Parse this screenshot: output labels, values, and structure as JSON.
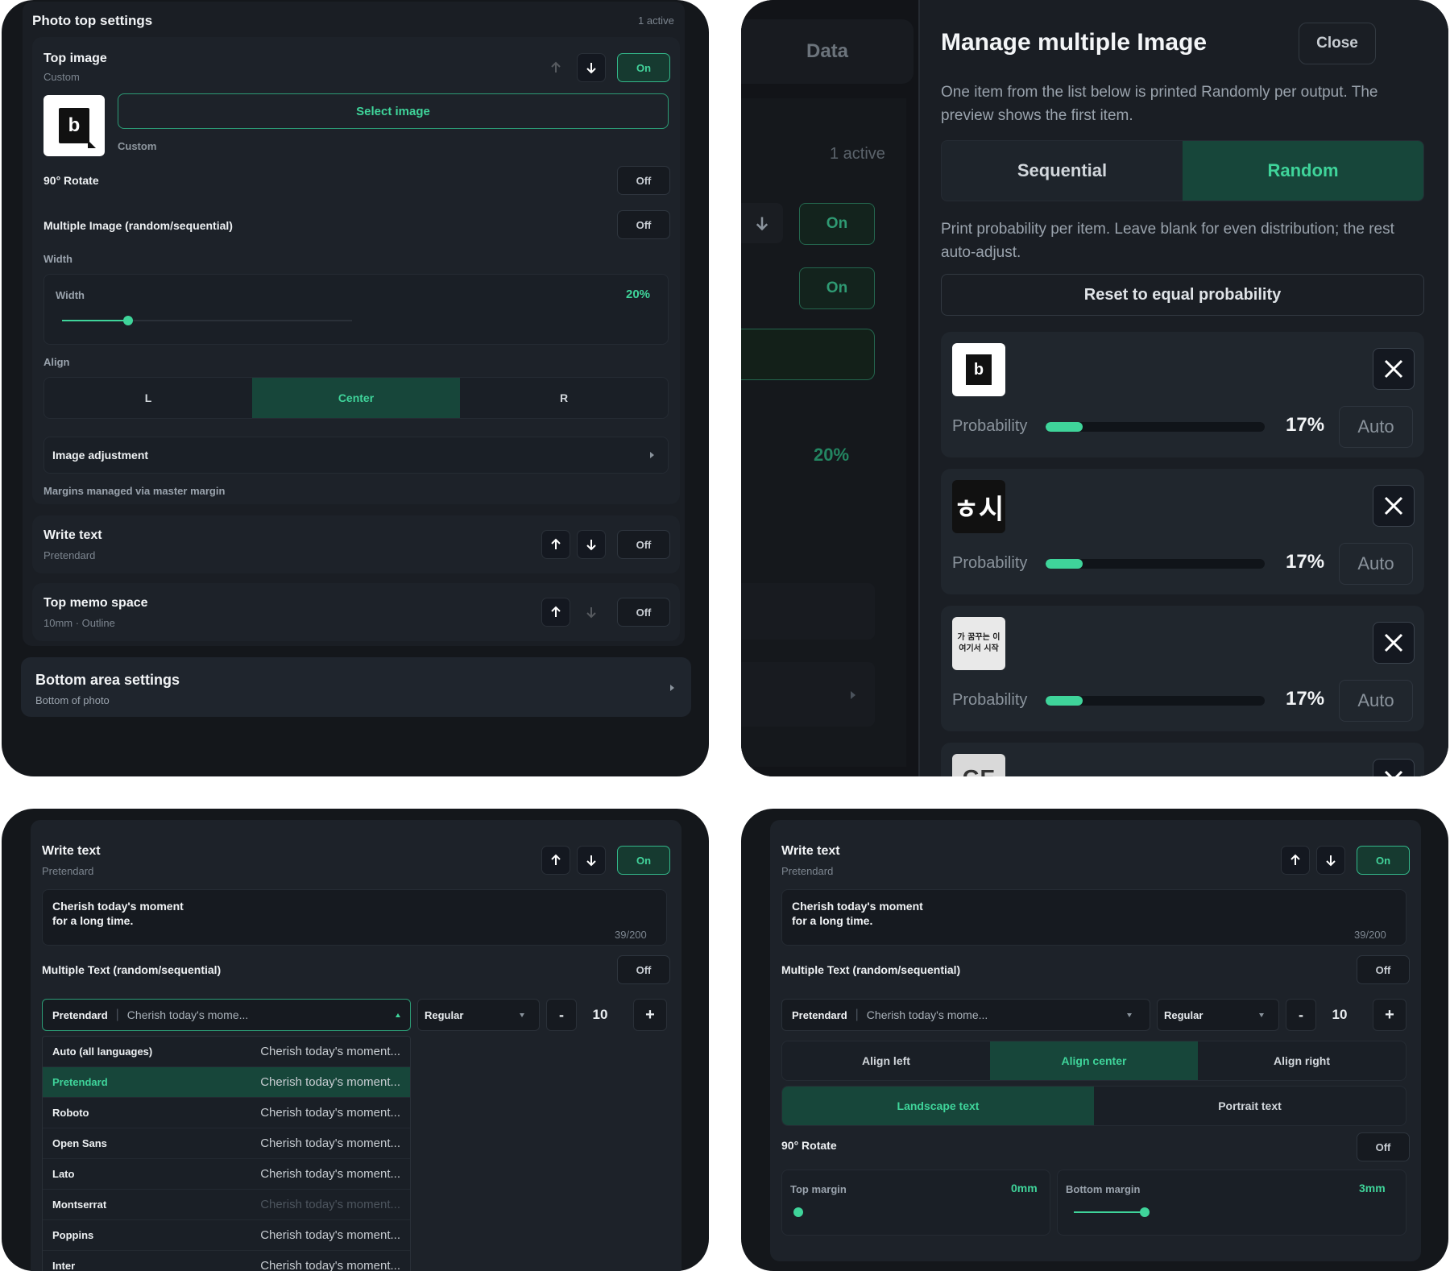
{
  "panel1": {
    "header_title": "Photo top settings",
    "header_status": "1 active",
    "top_image": {
      "title": "Top image",
      "subtitle": "Custom",
      "toggle": "On",
      "select_button": "Select image",
      "thumb_caption": "Custom",
      "thumb_glyph": "b"
    },
    "rotate": {
      "label": "90° Rotate",
      "toggle": "Off"
    },
    "multi_image": {
      "label": "Multiple Image (random/sequential)",
      "toggle": "Off"
    },
    "width_section_label": "Width",
    "width_slider": {
      "label": "Width",
      "value": "20%",
      "fraction": 0.2
    },
    "align_label": "Align",
    "align_options": [
      "L",
      "Center",
      "R"
    ],
    "align_selected": "Center",
    "image_adjustment": "Image adjustment",
    "margins_note": "Margins managed via master margin",
    "write_text": {
      "title": "Write text",
      "subtitle": "Pretendard",
      "toggle": "Off"
    },
    "top_memo": {
      "title": "Top memo space",
      "subtitle": "10mm · Outline",
      "toggle": "Off"
    },
    "bottom_area": {
      "title": "Bottom area settings",
      "subtitle": "Bottom of photo"
    }
  },
  "panel2": {
    "bg": {
      "tab": "Data",
      "status": "1 active",
      "toggle_a": "On",
      "toggle_b": "On",
      "percent": "20%"
    },
    "modal": {
      "title": "Manage multiple Image",
      "close": "Close",
      "description": "One item from the list below is printed Randomly per output. The preview shows the first item.",
      "modes": [
        "Sequential",
        "Random"
      ],
      "mode_selected": "Random",
      "prob_description": "Print probability per item. Leave blank for even distribution; the rest auto-adjust.",
      "reset_button": "Reset to equal probability",
      "items": [
        {
          "thumb": "b",
          "prob_label": "Probability",
          "percent": "17%",
          "fraction": 0.17,
          "auto": "Auto"
        },
        {
          "thumb": "ㅎ시",
          "prob_label": "Probability",
          "percent": "17%",
          "fraction": 0.17,
          "auto": "Auto"
        },
        {
          "thumb": "가 꿈꾸는 이 여기서 시작",
          "prob_label": "Probability",
          "percent": "17%",
          "fraction": 0.17,
          "auto": "Auto"
        },
        {
          "thumb": "GE"
        }
      ]
    }
  },
  "panel3": {
    "write_text": {
      "title": "Write text",
      "subtitle": "Pretendard",
      "toggle": "On"
    },
    "textarea": {
      "line1": "Cherish today's moment",
      "line2": "for a long time.",
      "counter": "39/200"
    },
    "multi_text": {
      "label": "Multiple Text (random/sequential)",
      "toggle": "Off"
    },
    "font_select": {
      "font": "Pretendard",
      "preview": "Cherish today's mome..."
    },
    "weight_select": "Regular",
    "size": {
      "minus": "-",
      "value": "10",
      "plus": "+"
    },
    "font_options": [
      {
        "name": "Auto (all languages)",
        "preview": "Cherish today's moment..."
      },
      {
        "name": "Pretendard",
        "preview": "Cherish today's moment..."
      },
      {
        "name": "Roboto",
        "preview": "Cherish today's moment..."
      },
      {
        "name": "Open Sans",
        "preview": "Cherish today's moment..."
      },
      {
        "name": "Lato",
        "preview": "Cherish today's moment..."
      },
      {
        "name": "Montserrat",
        "preview": "Cherish today's moment..."
      },
      {
        "name": "Poppins",
        "preview": "Cherish today's moment..."
      },
      {
        "name": "Inter",
        "preview": "Cherish today's moment..."
      }
    ],
    "font_selected": "Pretendard"
  },
  "panel4": {
    "write_text": {
      "title": "Write text",
      "subtitle": "Pretendard",
      "toggle": "On"
    },
    "textarea": {
      "line1": "Cherish today's moment",
      "line2": "for a long time.",
      "counter": "39/200"
    },
    "multi_text": {
      "label": "Multiple Text (random/sequential)",
      "toggle": "Off"
    },
    "font_select": {
      "font": "Pretendard",
      "preview": "Cherish today's mome..."
    },
    "weight_select": "Regular",
    "size": {
      "minus": "-",
      "value": "10",
      "plus": "+"
    },
    "align_options": [
      "Align left",
      "Align center",
      "Align right"
    ],
    "align_selected": "Align center",
    "orientation_options": [
      "Landscape text",
      "Portrait text"
    ],
    "orientation_selected": "Landscape text",
    "rotate": {
      "label": "90° Rotate",
      "toggle": "Off"
    },
    "top_margin": {
      "label": "Top margin",
      "value": "0mm",
      "fraction": 0.0
    },
    "bottom_margin": {
      "label": "Bottom margin",
      "value": "3mm",
      "fraction": 1.0
    }
  },
  "colors": {
    "accent": "#3fd49a",
    "panel_bg": "#14171b",
    "card_bg": "#1d2229",
    "active_bg": "#17463a"
  },
  "icons": [
    "arrow-up-icon",
    "arrow-down-icon",
    "close-icon",
    "chevron-right-icon",
    "caret-up-icon",
    "caret-down-icon"
  ]
}
